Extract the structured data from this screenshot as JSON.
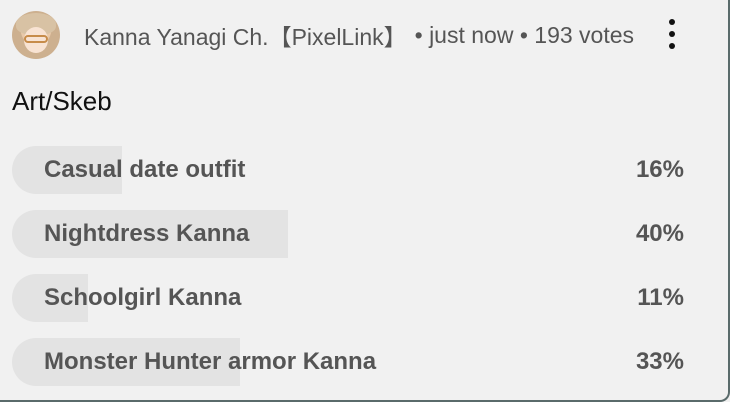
{
  "header": {
    "author": "Kanna Yanagi Ch.【PixelLink】",
    "meta": "• just now • 193 votes"
  },
  "poll": {
    "title": "Art/Skeb",
    "options": [
      {
        "label": "Casual date outfit",
        "percent": "16%",
        "share": 0.16
      },
      {
        "label": "Nightdress Kanna",
        "percent": "40%",
        "share": 0.4
      },
      {
        "label": "Schoolgirl Kanna",
        "percent": "11%",
        "share": 0.11
      },
      {
        "label": "Monster Hunter armor Kanna",
        "percent": "33%",
        "share": 0.33
      }
    ]
  },
  "icons": {
    "avatar": "avatar-image",
    "more": "more-vert-icon"
  },
  "colors": {
    "background": "#f1f1f1",
    "bar_fill": "#e3e3e3",
    "text_primary": "#111111",
    "text_secondary": "#555555"
  }
}
